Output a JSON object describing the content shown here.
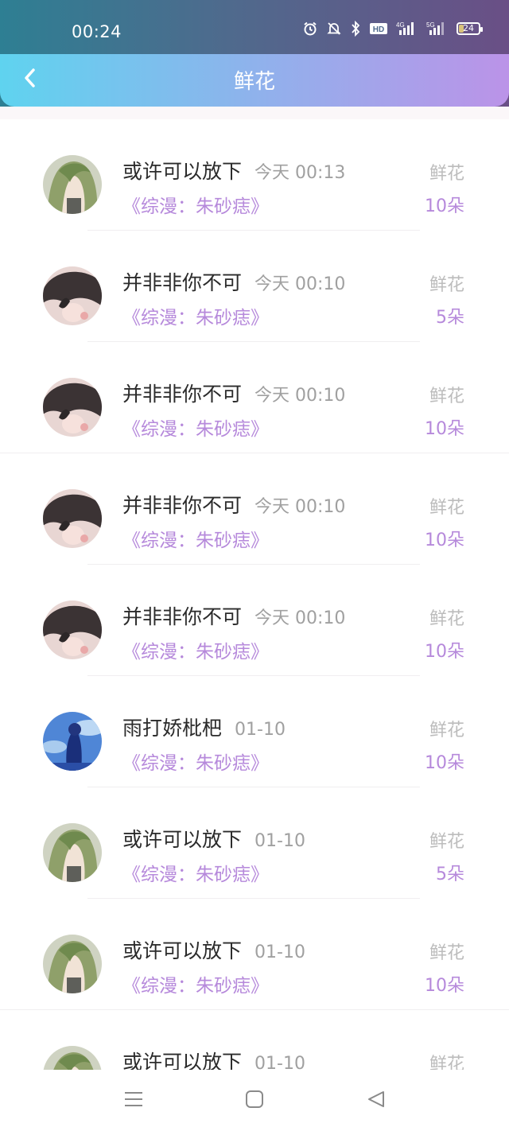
{
  "status": {
    "time": "00:24",
    "battery": "24",
    "icons": [
      "alarm-icon",
      "mute-icon",
      "bluetooth-icon",
      "hd-icon",
      "signal-4g-icon",
      "signal-5g-icon",
      "battery-icon"
    ]
  },
  "header": {
    "title": "鲜花",
    "back_icon": "chevron-left-icon"
  },
  "list": {
    "items": [
      {
        "name": "或许可以放下",
        "time": "今天 00:13",
        "book": "《综漫：朱砂痣》",
        "gift": "鲜花",
        "count": "10朵",
        "avatar": "green-hair"
      },
      {
        "name": "并非非你不可",
        "time": "今天 00:10",
        "book": "《综漫：朱砂痣》",
        "gift": "鲜花",
        "count": "5朵",
        "avatar": "dark-hair"
      },
      {
        "name": "并非非你不可",
        "time": "今天 00:10",
        "book": "《综漫：朱砂痣》",
        "gift": "鲜花",
        "count": "10朵",
        "avatar": "dark-hair"
      },
      {
        "name": "并非非你不可",
        "time": "今天 00:10",
        "book": "《综漫：朱砂痣》",
        "gift": "鲜花",
        "count": "10朵",
        "avatar": "dark-hair"
      },
      {
        "name": "并非非你不可",
        "time": "今天 00:10",
        "book": "《综漫：朱砂痣》",
        "gift": "鲜花",
        "count": "10朵",
        "avatar": "dark-hair"
      },
      {
        "name": "雨打娇枇杷",
        "time": "01-10",
        "book": "《综漫：朱砂痣》",
        "gift": "鲜花",
        "count": "10朵",
        "avatar": "blue-sky"
      },
      {
        "name": "或许可以放下",
        "time": "01-10",
        "book": "《综漫：朱砂痣》",
        "gift": "鲜花",
        "count": "5朵",
        "avatar": "green-hair"
      },
      {
        "name": "或许可以放下",
        "time": "01-10",
        "book": "《综漫：朱砂痣》",
        "gift": "鲜花",
        "count": "10朵",
        "avatar": "green-hair"
      },
      {
        "name": "或许可以放下",
        "time": "01-10",
        "book": "",
        "gift": "鲜花",
        "count": "",
        "avatar": "green-hair"
      }
    ]
  },
  "navbar": {
    "icons": [
      "menu-icon",
      "home-square-icon",
      "back-triangle-icon"
    ]
  },
  "colors": {
    "header_start": "#5fd3ef",
    "header_end": "#bb93e8",
    "accent_purple": "#b689db"
  }
}
